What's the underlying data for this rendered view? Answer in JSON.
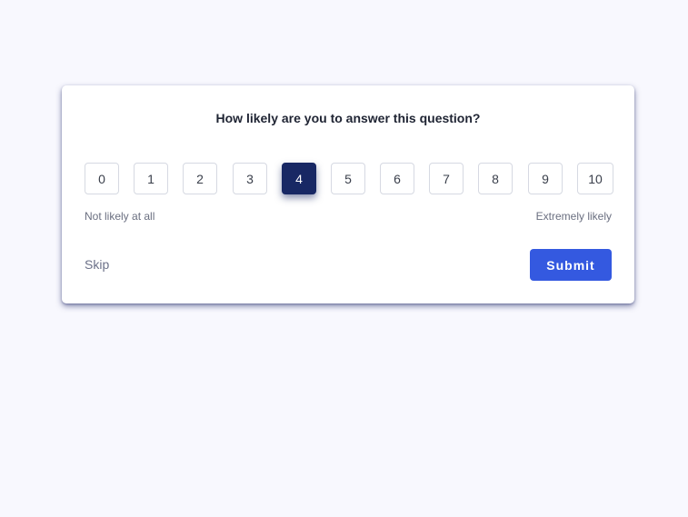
{
  "survey": {
    "question": "How likely are you to answer this question?",
    "scale": [
      "0",
      "1",
      "2",
      "3",
      "4",
      "5",
      "6",
      "7",
      "8",
      "9",
      "10"
    ],
    "selected": "4",
    "low_label": "Not likely at all",
    "high_label": "Extremely likely",
    "skip_label": "Skip",
    "submit_label": "Submit"
  },
  "colors": {
    "background": "#f8f8fe",
    "selected": "#182864",
    "submit": "#3459e0"
  }
}
